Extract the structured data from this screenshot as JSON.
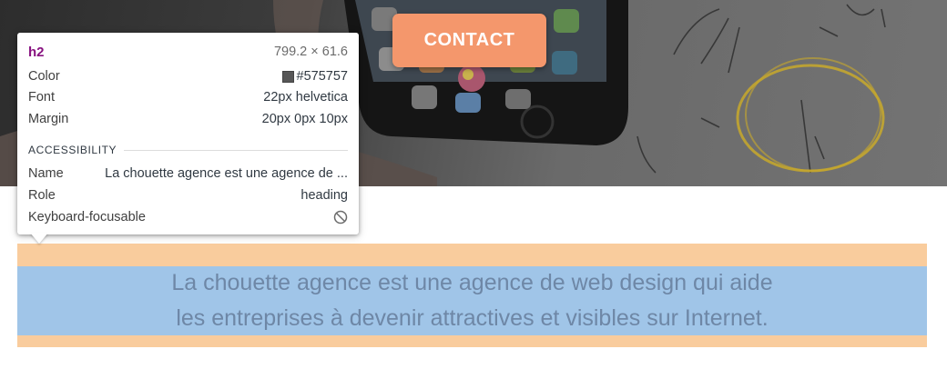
{
  "hero": {
    "contact_label": "CONTACT"
  },
  "heading": {
    "line1": "La chouette agence est une agence de web design qui aide",
    "line2": "les entreprises à devenir attractives et visibles sur Internet."
  },
  "inspector": {
    "tag": "h2",
    "dimensions": "799.2 × 61.6",
    "rows": [
      {
        "label": "Color",
        "value": "#575757"
      },
      {
        "label": "Font",
        "value": "22px helvetica"
      },
      {
        "label": "Margin",
        "value": "20px 0px 10px"
      }
    ],
    "accessibility": {
      "title": "ACCESSIBILITY",
      "name_label": "Name",
      "name_value": "La chouette agence est une agence de ...",
      "role_label": "Role",
      "role_value": "heading",
      "focus_label": "Keyboard-focusable",
      "focus_icon": "not-allowed-icon"
    }
  },
  "colors": {
    "contact_button": "#f4976c",
    "margin_overlay": "#f9cc9d",
    "content_overlay": "#a0c5e8",
    "text_color_swatch": "#575757",
    "tag_color": "#881280"
  }
}
